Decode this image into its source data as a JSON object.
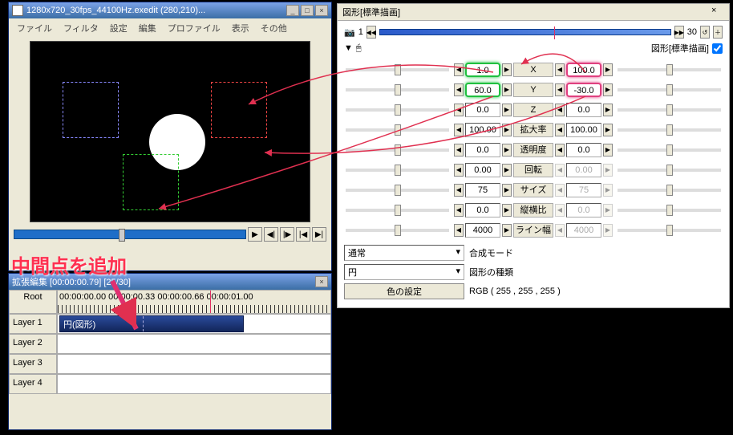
{
  "preview_window": {
    "title": "1280x720_30fps_44100Hz.exedit (280,210)...",
    "menu": [
      "ファイル",
      "フィルタ",
      "設定",
      "編集",
      "プロファイル",
      "表示",
      "その他"
    ]
  },
  "transport": {
    "play": "▶",
    "stepb": "◀|",
    "stepf": "|▶",
    "start": "|◀",
    "end": "▶|"
  },
  "timeline": {
    "title": "拡張編集 [00:00:00.79] [25/30]",
    "root": "Root",
    "ruler": "00:00:00.00   00:00:00.33   00:00:00.66   00:00:01.00",
    "layers": [
      "Layer 1",
      "Layer 2",
      "Layer 3",
      "Layer 4"
    ],
    "clip": "円(図形)"
  },
  "annotation": "中間点を追加",
  "prop": {
    "title": "図形[標準描画]",
    "frame_start": "1",
    "frame_end": "30",
    "drawing_label": "図形[標準描画]",
    "params": {
      "X": {
        "label": "X",
        "left": "1.0",
        "right": "100.0"
      },
      "Y": {
        "label": "Y",
        "left": "60.0",
        "right": "-30.0"
      },
      "Z": {
        "label": "Z",
        "left": "0.0",
        "right": "0.0"
      },
      "scale": {
        "label": "拡大率",
        "left": "100.00",
        "right": "100.00"
      },
      "alpha": {
        "label": "透明度",
        "left": "0.0",
        "right": "0.0"
      },
      "rot": {
        "label": "回転",
        "left": "0.00",
        "right": "0.00"
      },
      "size": {
        "label": "サイズ",
        "left": "75",
        "right": "75"
      },
      "aspect": {
        "label": "縦横比",
        "left": "0.0",
        "right": "0.0"
      },
      "line": {
        "label": "ライン幅",
        "left": "4000",
        "right": "4000"
      }
    },
    "blend_mode": {
      "value": "通常",
      "label": "合成モード"
    },
    "shape_type": {
      "value": "円",
      "label": "図形の種類"
    },
    "color": {
      "button": "色の設定",
      "value": "RGB ( 255 , 255 , 255 )"
    }
  }
}
